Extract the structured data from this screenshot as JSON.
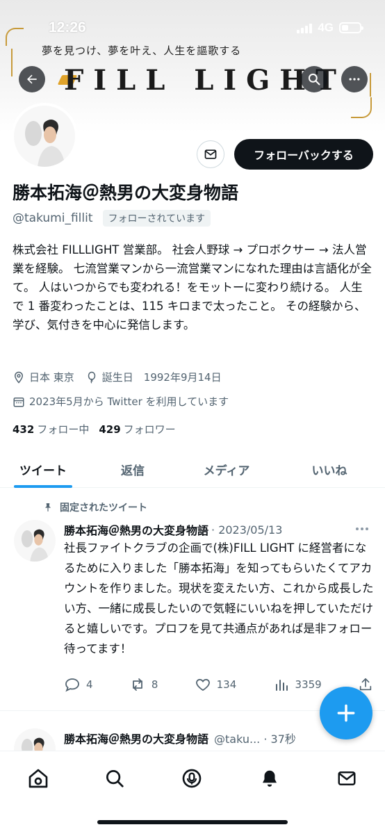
{
  "status_bar": {
    "time": "12:26",
    "network": "4G"
  },
  "banner": {
    "tagline": "夢を見つけ、夢を叶え、人生を謳歌する",
    "logo_text": "FILL LIGHT"
  },
  "header_icons": [
    "back-arrow-icon",
    "search-icon",
    "more-horizontal-icon"
  ],
  "profile": {
    "follow_button": "フォローバックする",
    "display_name": "勝本拓海＠熱男の大変身物語",
    "handle": "@takumi_fillit",
    "follows_you": "フォローされています",
    "bio": "株式会社 FILLLIGHT 営業部。 社会人野球 → プロボクサー → 法人営業を経験。 七流営業マンから一流営業マンになれた理由は言語化が全て。 人はいつからでも変われる！をモットーに変わり続ける。 人生で 1 番変わったことは、115 キロまで太ったこと。 その経験から、学び、気付きを中心に発信します。",
    "location": "日本 東京",
    "birthday": "誕生日　1992年9月14日",
    "joined": "2023年5月から Twitter を利用しています",
    "following_count": "432",
    "following_label": "フォロー中",
    "followers_count": "429",
    "followers_label": "フォロワー"
  },
  "tabs": [
    {
      "label": "ツイート",
      "active": true
    },
    {
      "label": "返信",
      "active": false
    },
    {
      "label": "メディア",
      "active": false
    },
    {
      "label": "いいね",
      "active": false
    }
  ],
  "pinned_tweet": {
    "pinned_label": "固定されたツイート",
    "author": "勝本拓海＠熱男の大変身物語",
    "date": "· 2023/05/13",
    "text": "社長ファイトクラブの企画で(株)FILL LIGHT に経営者になるために入りました「勝本拓海」を知ってもらいたくてアカウントを作りました。現状を変えたい方、これから成長したい方、一緒に成長したいので気軽にいいねを押していただけると嬉しいです。プロフを見て共通点があれば是非フォロー待ってます！",
    "replies": "4",
    "retweets": "8",
    "likes": "134",
    "views": "3359"
  },
  "second_tweet": {
    "author": "勝本拓海＠熱男の大変身物語",
    "handle_time": "@taku... · 37秒"
  },
  "bottom_nav": [
    "home-icon",
    "search-icon",
    "spaces-icon",
    "notifications-icon",
    "messages-icon"
  ],
  "colors": {
    "accent": "#1d9bf0",
    "text": "#0f1419",
    "secondary": "#536471",
    "follow_button": "#0f1419"
  }
}
